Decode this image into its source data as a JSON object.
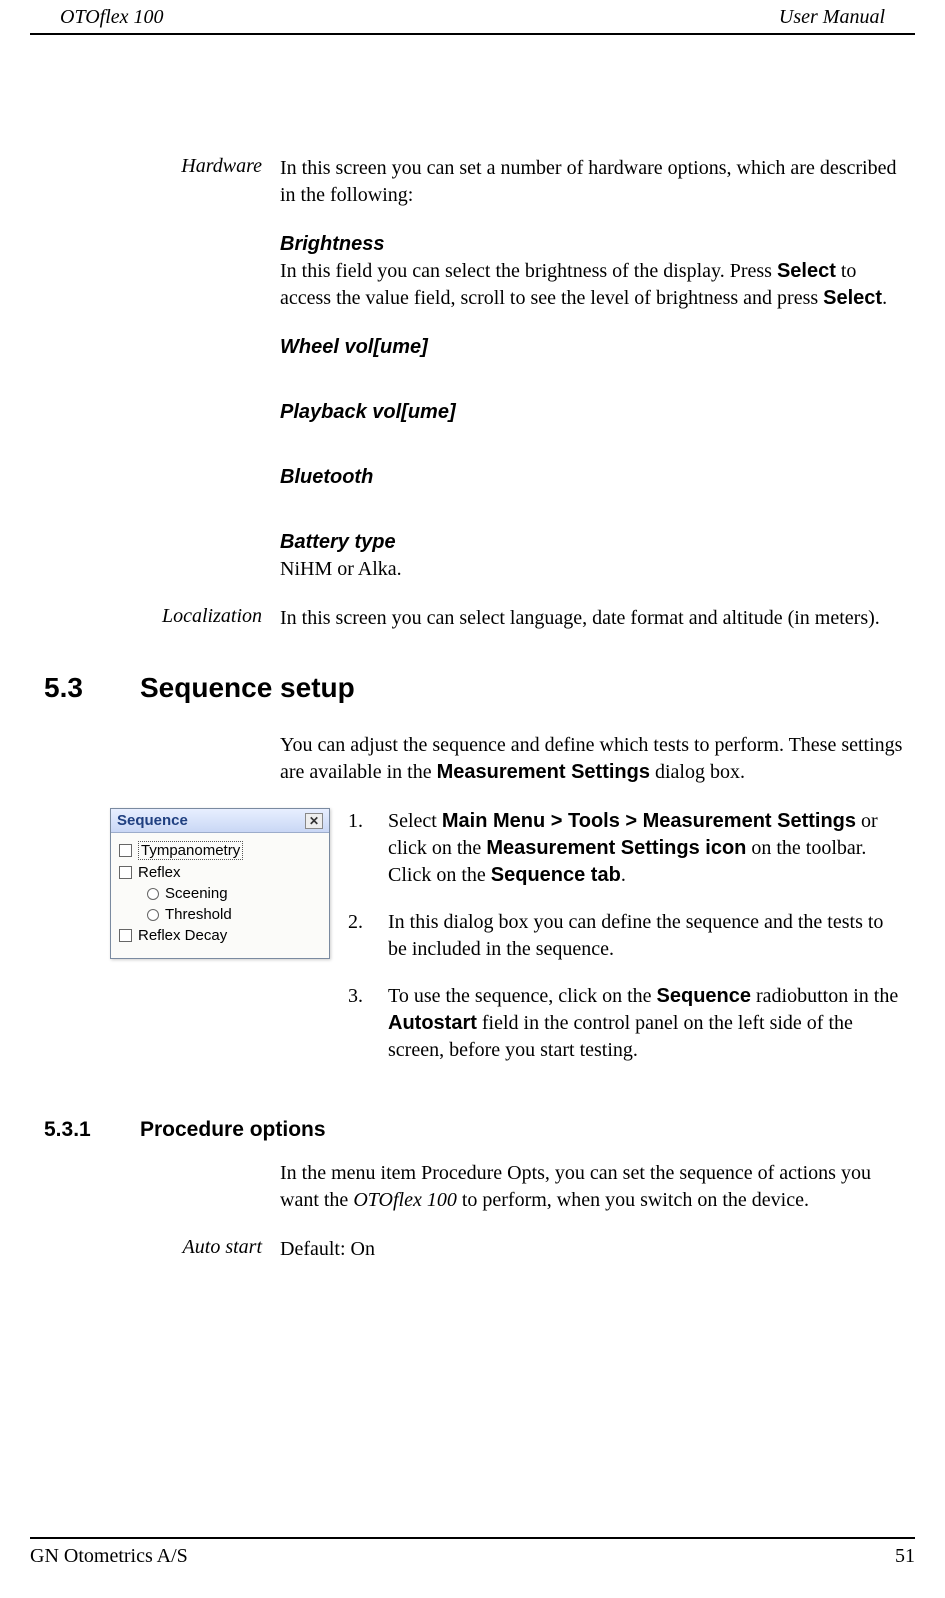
{
  "header": {
    "left": "OTOflex 100",
    "right": "User Manual"
  },
  "hardware": {
    "label": "Hardware",
    "intro": "In this screen you can set a number of hardware options, which are described in the following:",
    "brightness": {
      "title": "Brightness",
      "text_a": "In this field you can select the brightness of the display. Press ",
      "select1": "Select",
      "text_b": " to access the value field, scroll to see the level of brightness and press ",
      "select2": "Select",
      "text_c": "."
    },
    "wheel": {
      "title": "Wheel vol[ume]"
    },
    "playback": {
      "title": "Playback vol[ume]"
    },
    "bluetooth": {
      "title": "Bluetooth"
    },
    "battery": {
      "title": "Battery type",
      "text": "NiHM or Alka."
    }
  },
  "localization": {
    "label": "Localization",
    "text": "In this screen you can select language, date format and altitude (in meters)."
  },
  "section": {
    "num": "5.3",
    "title": "Sequence setup",
    "intro_a": "You can adjust the sequence and define which tests to perform. These settings are available in the ",
    "intro_b": "Measurement Settings",
    "intro_c": " dialog box.",
    "steps": [
      {
        "n": "1.",
        "parts": [
          "Select ",
          "Main Menu > Tools > Measurement Settings",
          " or click on the ",
          "Measurement Settings icon",
          " on the toolbar. Click on the ",
          "Sequence tab",
          "."
        ]
      },
      {
        "n": "2.",
        "text": "In this dialog box you can define the sequence and the tests to be included in the sequence."
      },
      {
        "n": "3.",
        "parts": [
          "To use the sequence, click on the ",
          "Sequence",
          " radiobutton in the ",
          "Autostart",
          " field in the control panel on the left side of the screen, before you start testing."
        ]
      }
    ]
  },
  "dialog": {
    "title": "Sequence",
    "items": [
      "Tympanometry",
      "Reflex",
      "Sceening",
      "Threshold",
      "Reflex Decay"
    ]
  },
  "subsection": {
    "num": "5.3.1",
    "title": "Procedure options",
    "text_a": "In the menu item Procedure Opts, you can set the sequence of actions you want the ",
    "text_em": "OTOflex 100",
    "text_b": " to perform, when you switch on the device."
  },
  "autostart": {
    "label": "Auto start",
    "value": "Default: On"
  },
  "footer": {
    "left": "GN Otometrics A/S",
    "right": "51"
  }
}
